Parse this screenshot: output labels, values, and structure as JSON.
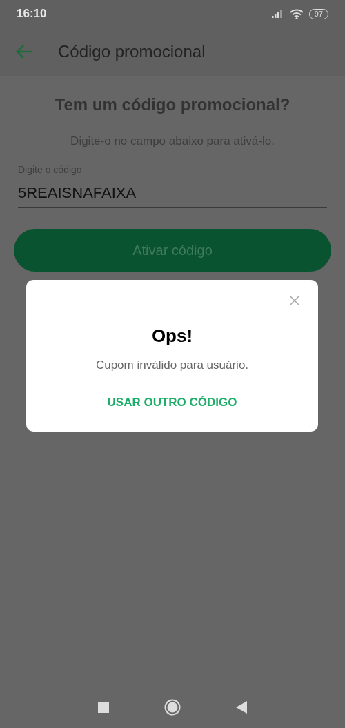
{
  "status_bar": {
    "time": "16:10",
    "battery": "97"
  },
  "header": {
    "title": "Código promocional"
  },
  "content": {
    "heading": "Tem um código promocional?",
    "subtitle": "Digite-o no campo abaixo para ativá-lo.",
    "field": {
      "label": "Digite o código",
      "value": "5REAISNAFAIXA"
    },
    "button": "Ativar código"
  },
  "dialog": {
    "title": "Ops!",
    "message": "Cupom inválido para usuário.",
    "action": "USAR OUTRO CÓDIGO"
  }
}
